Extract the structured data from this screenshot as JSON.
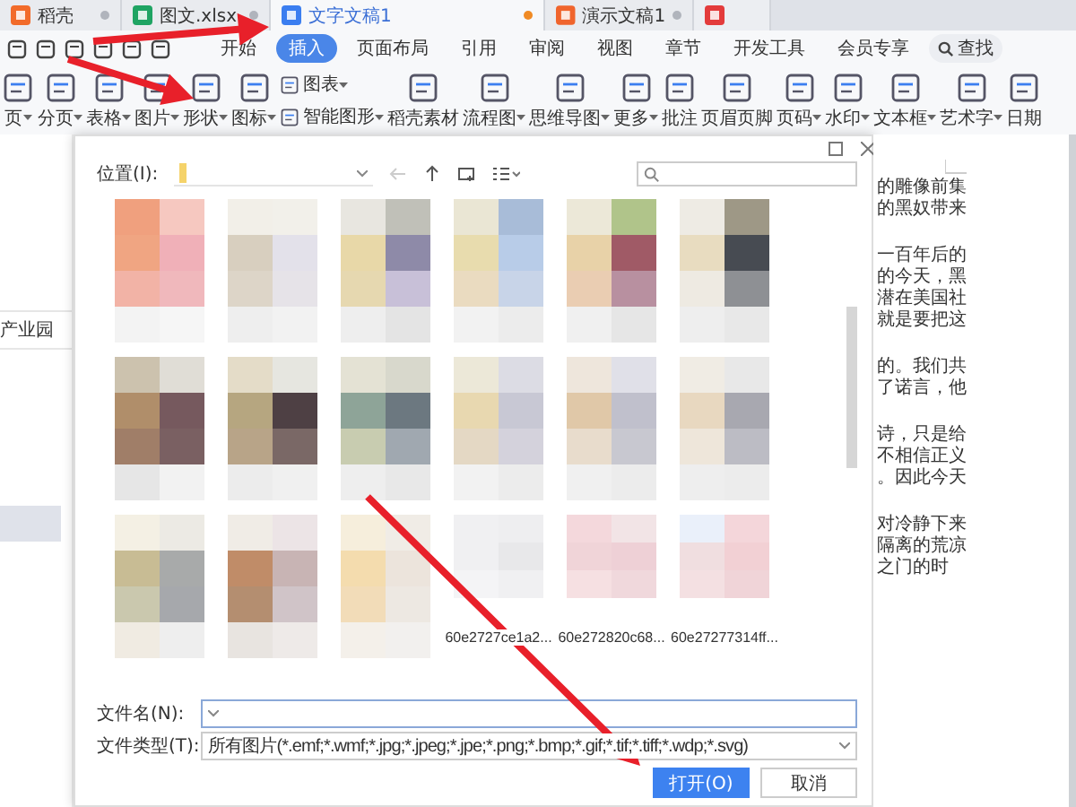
{
  "tabs": [
    {
      "label": "稻壳",
      "selected": false,
      "kind": "docer"
    },
    {
      "label": "图文.xlsx",
      "selected": false,
      "kind": "sheet"
    },
    {
      "label": "文字文稿1",
      "selected": true,
      "kind": "writer"
    },
    {
      "label": "演示文稿1",
      "selected": false,
      "kind": "slides"
    },
    {
      "selected": false,
      "kind": "pdf"
    }
  ],
  "menu": [
    {
      "label": "开始",
      "selected": false
    },
    {
      "label": "插入",
      "selected": true
    },
    {
      "label": "页面布局",
      "selected": false
    },
    {
      "label": "引用",
      "selected": false
    },
    {
      "label": "审阅",
      "selected": false
    },
    {
      "label": "视图",
      "selected": false
    },
    {
      "label": "章节",
      "selected": false
    },
    {
      "label": "开发工具",
      "selected": false
    },
    {
      "label": "会员专享",
      "selected": false
    }
  ],
  "search": {
    "label": "查找"
  },
  "ribbon": [
    {
      "label": "页",
      "dropdown": true
    },
    {
      "label": "分页",
      "dropdown": true
    },
    {
      "label": "表格",
      "dropdown": true
    },
    {
      "label": "图片",
      "dropdown": true
    },
    {
      "label": "形状",
      "dropdown": true
    },
    {
      "label": "图标",
      "dropdown": true
    },
    {
      "label": "图表",
      "dropdown": true,
      "kind": "small"
    },
    {
      "label": "智能图形",
      "dropdown": true,
      "kind": "small"
    },
    {
      "label": "稻壳素材",
      "dropdown": false
    },
    {
      "label": "流程图",
      "dropdown": true
    },
    {
      "label": "思维导图",
      "dropdown": true
    },
    {
      "label": "更多",
      "dropdown": true
    },
    {
      "label": "批注",
      "dropdown": false
    },
    {
      "label": "页眉页脚",
      "dropdown": false
    },
    {
      "label": "页码",
      "dropdown": true
    },
    {
      "label": "水印",
      "dropdown": true
    },
    {
      "label": "文本框",
      "dropdown": true
    },
    {
      "label": "艺术字",
      "dropdown": true
    },
    {
      "label": "日期",
      "dropdown": false
    }
  ],
  "left_panel": {
    "text": "产业园"
  },
  "dialog": {
    "location_label": "位置(I):",
    "files": [
      {
        "kind": "picture"
      },
      {
        "kind": "picture"
      },
      {
        "kind": "picture"
      },
      {
        "kind": "picture"
      },
      {
        "kind": "picture"
      },
      {
        "kind": "picture"
      },
      {
        "kind": "picture"
      },
      {
        "kind": "picture"
      },
      {
        "kind": "picture"
      },
      {
        "kind": "picture"
      },
      {
        "kind": "picture"
      },
      {
        "kind": "picture"
      },
      {
        "kind": "picture"
      },
      {
        "kind": "picture"
      },
      {
        "kind": "picture"
      },
      {
        "kind": "picture",
        "name": "60e2727ce1a2..."
      },
      {
        "kind": "picture",
        "name": "60e272820c68..."
      },
      {
        "kind": "picture",
        "name": "60e27277314ff..."
      }
    ],
    "filename_label": "文件名(N):",
    "filetype_label": "文件类型(T):",
    "filetype_value": "所有图片(*.emf;*.wmf;*.jpg;*.jpeg;*.jpe;*.png;*.bmp;*.gif;*.tif;*.tiff;*.wdp;*.svg)",
    "buttons": [
      {
        "label": "打开(O)",
        "kind": "primary"
      },
      {
        "label": "取消",
        "kind": "secondary"
      }
    ]
  },
  "document": {
    "paragraphs": [
      [
        "的雕像前集",
        "的黑奴带来"
      ],
      [
        "一百年后的",
        "的今天，黑",
        "潜在美国社",
        "就是要把这"
      ],
      [
        "的。我们共",
        "了诺言，他"
      ],
      [
        "诗，只是给",
        "不相信正义",
        "。因此今天"
      ],
      [
        "对冷静下来",
        "隔离的荒凉",
        "之门的时"
      ]
    ]
  }
}
